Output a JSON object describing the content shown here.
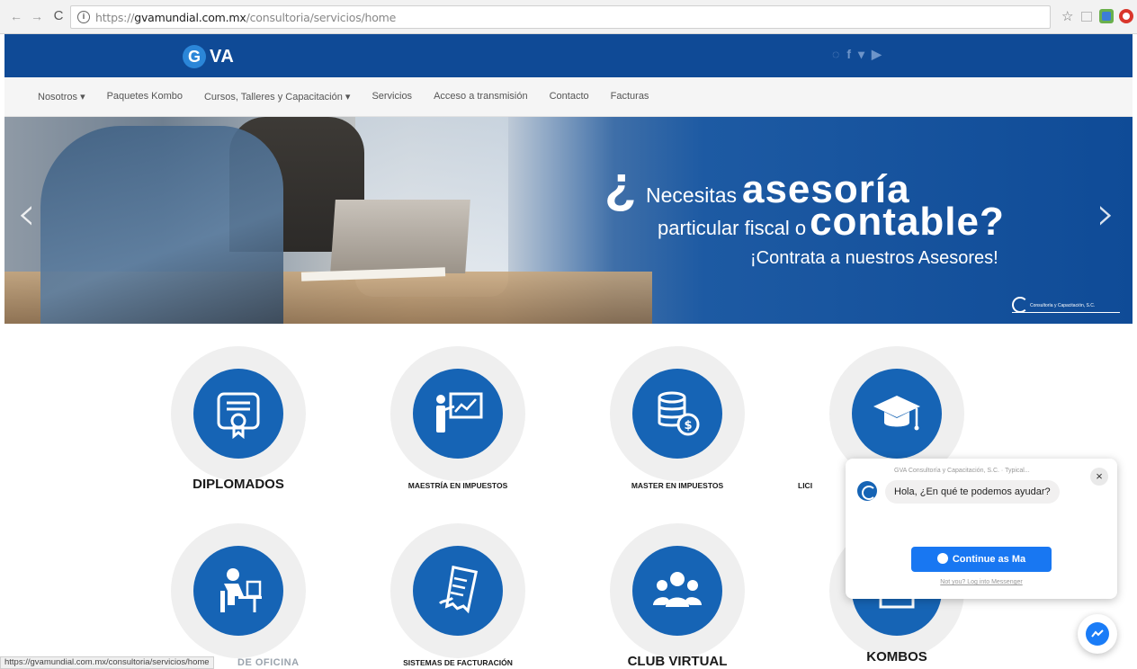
{
  "browser": {
    "url_scheme": "https://",
    "url_host": "gvamundial.com.mx",
    "url_path": "/consultoria/servicios/home"
  },
  "header": {
    "logo_letter": "G",
    "logo_text": "VA",
    "social": [
      "whatsapp-icon",
      "facebook-icon",
      "twitter-icon",
      "youtube-icon"
    ]
  },
  "nav": {
    "items": [
      "Nosotros ▾",
      "Paquetes Kombo",
      "Cursos, Talleres y Capacitación ▾",
      "Servicios",
      "Acceso a transmisión",
      "Contacto",
      "Facturas"
    ]
  },
  "hero": {
    "q_mark": "¿",
    "line1_small": "Necesitas",
    "line1_big": "asesoría",
    "line2_small": "particular fiscal o",
    "line2_big": "contable?",
    "line3": "¡Contrata a nuestros Asesores!",
    "stamp_text": "Consultoría y Capacitación, S.C.",
    "prev": "‹",
    "next": "›"
  },
  "services": [
    {
      "label": "DIPLOMADOS",
      "icon": "certificate-icon"
    },
    {
      "label": "MAESTRÍA EN IMPUESTOS",
      "icon": "presentation-icon"
    },
    {
      "label": "MASTER EN IMPUESTOS",
      "icon": "coins-icon"
    },
    {
      "label": "LICI",
      "icon": "graduation-cap-icon"
    },
    {
      "label": "DE OFICINA",
      "icon": "office-worker-icon"
    },
    {
      "label": "SISTEMAS DE FACTURACIÓN",
      "icon": "invoice-icon"
    },
    {
      "label": "CLUB VIRTUAL",
      "icon": "group-icon"
    },
    {
      "label": "KOMBOS",
      "icon": "box-icon"
    }
  ],
  "status_bar": {
    "url": "https://gvamundial.com.mx/consultoria/servicios/home"
  },
  "chat": {
    "meta": "GVA Consultoría y Capacitación, S.C. · Typical...",
    "message": "Hola, ¿En qué te podemos ayudar?",
    "button": "Continue as Ma",
    "login": "Not you? Log into Messenger",
    "close": "×"
  },
  "colors": {
    "brand_blue": "#0f4a96",
    "icon_blue": "#1664b5",
    "messenger_blue": "#1877f2"
  }
}
